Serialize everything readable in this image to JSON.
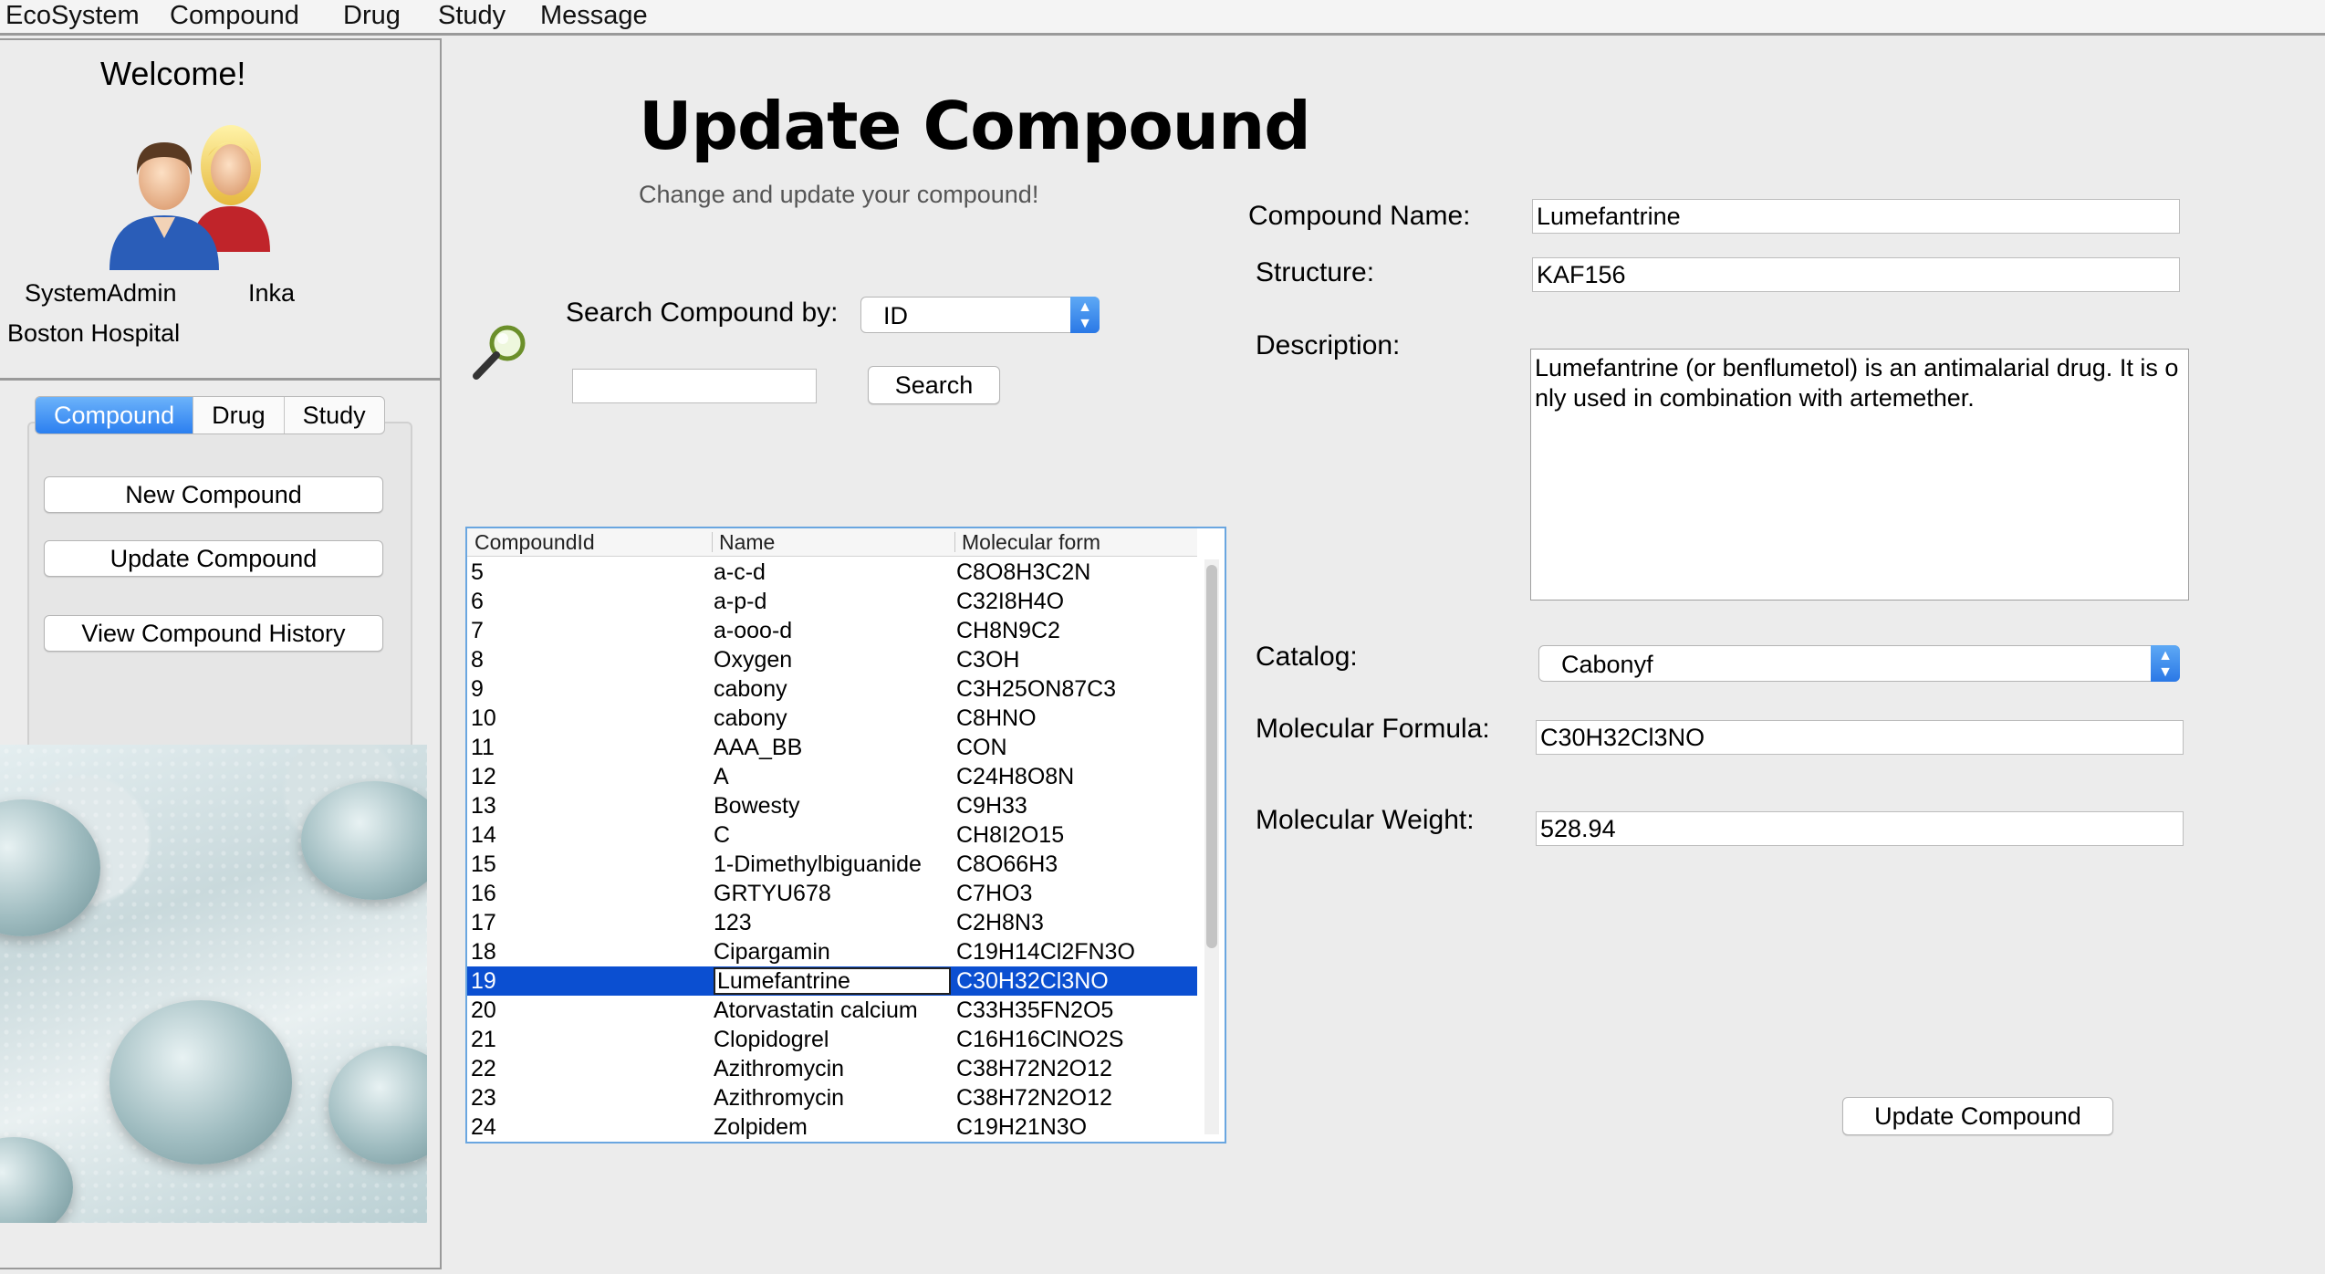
{
  "menu": [
    "EcoSystem",
    "Compound",
    "Drug",
    "Study",
    "Message"
  ],
  "sidebar": {
    "welcome": "Welcome!",
    "user_role": "SystemAdmin",
    "user_name": "Inka",
    "organization": "Boston Hospital",
    "tabs": [
      {
        "label": "Compound",
        "active": true
      },
      {
        "label": "Drug",
        "active": false
      },
      {
        "label": "Study",
        "active": false
      }
    ],
    "buttons": {
      "new_compound": "New Compound",
      "update_compound": "Update Compound",
      "view_history": "View Compound History"
    }
  },
  "page": {
    "title": "Update Compound",
    "subtitle": "Change and update your compound!"
  },
  "search": {
    "label": "Search Compound by:",
    "by_selected": "ID",
    "query": "",
    "button": "Search"
  },
  "table": {
    "columns": [
      "CompoundId",
      "Name",
      "Molecular form"
    ],
    "rows": [
      [
        "5",
        "a-c-d",
        "C8O8H3C2N"
      ],
      [
        "6",
        "a-p-d",
        "C32I8H4O"
      ],
      [
        "7",
        "a-ooo-d",
        "CH8N9C2"
      ],
      [
        "8",
        "Oxygen",
        "C3OH"
      ],
      [
        "9",
        "cabony",
        "C3H25ON87C3"
      ],
      [
        "10",
        "cabony",
        "C8HNO"
      ],
      [
        "11",
        "AAA_BB",
        "CON"
      ],
      [
        "12",
        "A",
        "C24H8O8N"
      ],
      [
        "13",
        "Bowesty",
        "C9H33"
      ],
      [
        "14",
        "C",
        "CH8I2O15"
      ],
      [
        "15",
        "1-Dimethylbiguanide",
        "C8O66H3"
      ],
      [
        "16",
        "GRTYU678",
        "C7HO3"
      ],
      [
        "17",
        "123",
        "C2H8N3"
      ],
      [
        "18",
        "Cipargamin",
        "C19H14Cl2FN3O"
      ],
      [
        "19",
        "Lumefantrine",
        "C30H32Cl3NO"
      ],
      [
        "20",
        "Atorvastatin calcium",
        "C33H35FN2O5"
      ],
      [
        "21",
        "Clopidogrel",
        "C16H16ClNO2S"
      ],
      [
        "22",
        "Azithromycin",
        "C38H72N2O12"
      ],
      [
        "23",
        "Azithromycin",
        "C38H72N2O12"
      ],
      [
        "24",
        "Zolpidem",
        "C19H21N3O"
      ]
    ],
    "selected_index": 14
  },
  "form": {
    "name_label": "Compound Name:",
    "name_value": "Lumefantrine",
    "structure_label": "Structure:",
    "structure_value": "KAF156",
    "description_label": "Description:",
    "description_value": "Lumefantrine (or benflumetol) is an antimalarial drug. It is only used in combination with artemether.",
    "catalog_label": "Catalog:",
    "catalog_value": "Cabonyf",
    "formula_label": "Molecular Formula:",
    "formula_value": "C30H32Cl3NO",
    "weight_label": "Molecular Weight:",
    "weight_value": "528.94",
    "submit": "Update Compound"
  },
  "colors": {
    "accent": "#2b7ff0",
    "selection": "#0b4fd1",
    "table_border": "#6aa6e0"
  }
}
